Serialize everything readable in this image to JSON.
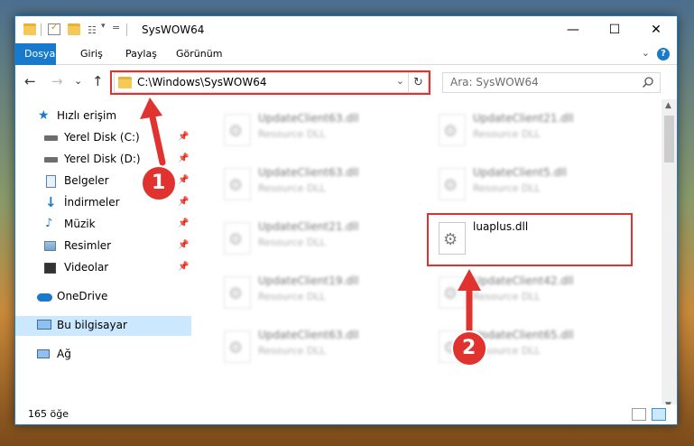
{
  "window": {
    "title": "SysWOW64",
    "controls": {
      "minimize": "—",
      "maximize": "☐",
      "close": "✕"
    }
  },
  "ribbon": {
    "tabs": [
      {
        "label": "Dosya",
        "active": true
      },
      {
        "label": "Giriş",
        "active": false
      },
      {
        "label": "Paylaş",
        "active": false
      },
      {
        "label": "Görünüm",
        "active": false
      }
    ],
    "help_icon": "?"
  },
  "navigation": {
    "back_icon": "←",
    "forward_icon": "→",
    "recent_icon": "⌄",
    "up_icon": "↑",
    "address_path": "C:\\Windows\\SysWOW64",
    "address_dropdown_icon": "⌄",
    "refresh_icon": "↻"
  },
  "search": {
    "placeholder": "Ara: SysWOW64",
    "icon": "search-icon"
  },
  "sidebar": {
    "items": [
      {
        "label": "Hızlı erişim",
        "icon": "star-icon",
        "pinned": false
      },
      {
        "label": "Yerel Disk (C:)",
        "icon": "drive-icon",
        "pinned": true
      },
      {
        "label": "Yerel Disk (D:)",
        "icon": "drive-icon",
        "pinned": true
      },
      {
        "label": "Belgeler",
        "icon": "documents-icon",
        "pinned": true
      },
      {
        "label": "İndirmeler",
        "icon": "download-icon",
        "pinned": true
      },
      {
        "label": "Müzik",
        "icon": "music-icon",
        "pinned": true
      },
      {
        "label": "Resimler",
        "icon": "pictures-icon",
        "pinned": true
      },
      {
        "label": "Videolar",
        "icon": "videos-icon",
        "pinned": true
      },
      {
        "label": "OneDrive",
        "icon": "cloud-icon",
        "pinned": false
      },
      {
        "label": "Bu bilgisayar",
        "icon": "computer-icon",
        "pinned": false,
        "selected": true
      },
      {
        "label": "Ağ",
        "icon": "network-icon",
        "pinned": false
      }
    ],
    "pin_icon": "📌"
  },
  "files": [
    {
      "name": "UpdateClient63.dll",
      "type": "Resource DLL",
      "blurred": true
    },
    {
      "name": "UpdateClient21.dll",
      "type": "Resource DLL",
      "blurred": true
    },
    {
      "name": "UpdateClient63.dll",
      "type": "Resource DLL",
      "blurred": true
    },
    {
      "name": "UpdateClient5.dll",
      "type": "Resource DLL",
      "blurred": true
    },
    {
      "name": "UpdateClient21.dll",
      "type": "Resource DLL",
      "blurred": true
    },
    {
      "name": "luaplus.dll",
      "type": "",
      "blurred": false,
      "highlighted": true
    },
    {
      "name": "UpdateClient19.dll",
      "type": "Resource DLL",
      "blurred": true
    },
    {
      "name": "UpdateClient42.dll",
      "type": "Resource DLL",
      "blurred": true
    },
    {
      "name": "UpdateClient63.dll",
      "type": "Resource DLL",
      "blurred": true
    },
    {
      "name": "UpdateClient65.dll",
      "type": "Resource DLL",
      "blurred": true
    }
  ],
  "status": {
    "item_count": "165 öğe"
  },
  "annotations": {
    "step1_label": "1",
    "step2_label": "2",
    "highlight_color": "#e0322e",
    "badge_color": "#e0322e"
  },
  "colors": {
    "accent": "#1979ca",
    "selected_bg": "#cce8ff"
  }
}
